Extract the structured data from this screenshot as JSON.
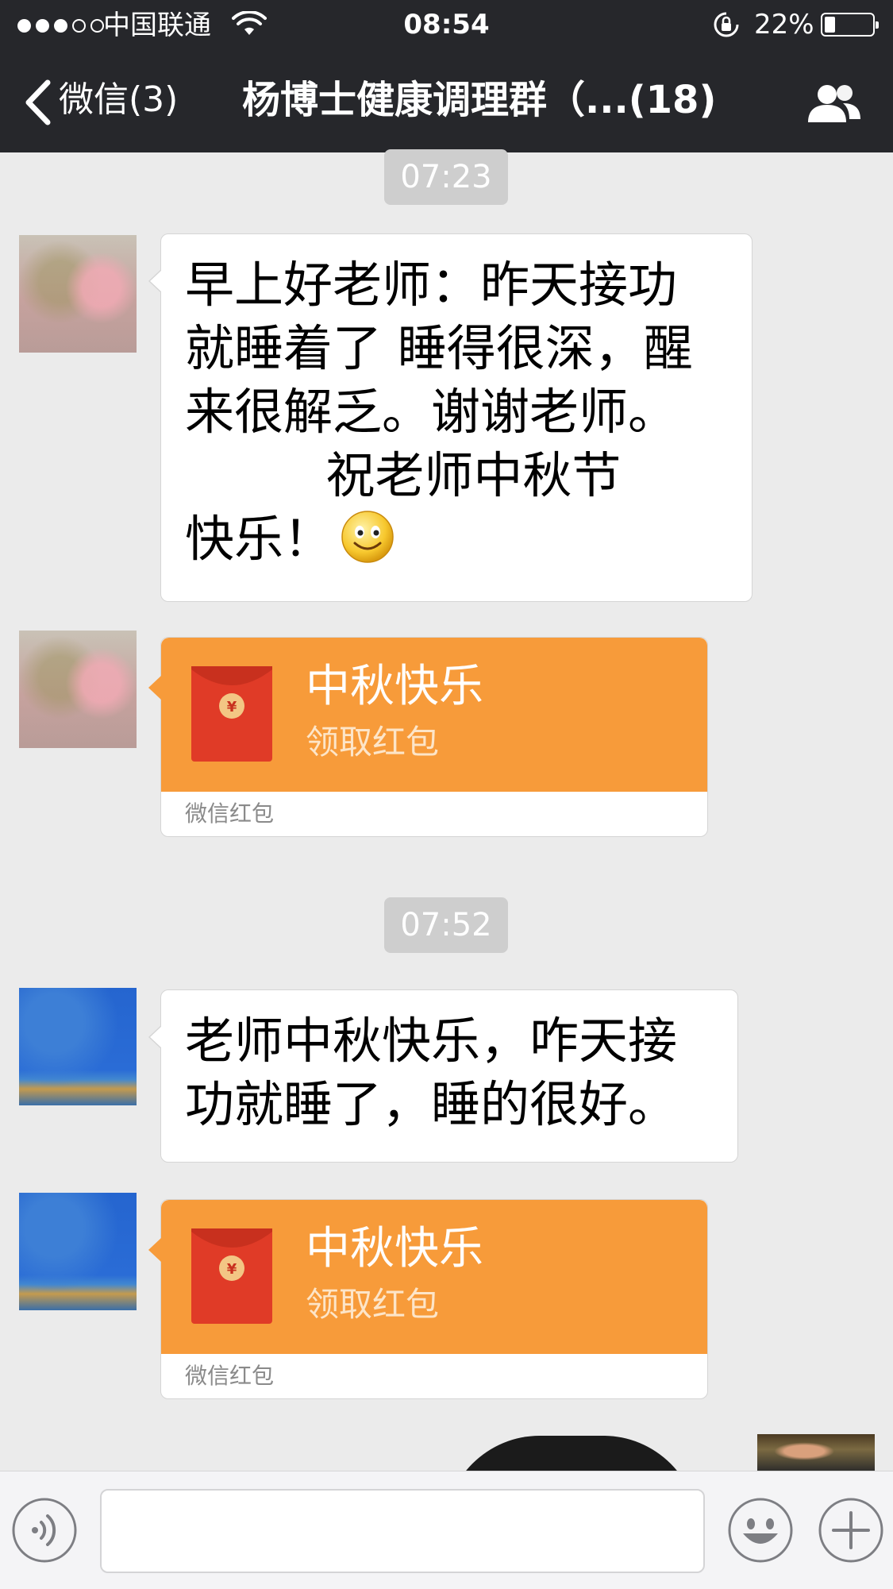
{
  "status_bar": {
    "carrier": "中国联通",
    "time": "08:54",
    "battery_percent": "22%",
    "battery_level": 0.22,
    "signal_bars": 3,
    "signal_total": 5
  },
  "nav": {
    "back_label": "微信(3)",
    "title": "杨博士健康调理群（...(18)",
    "group_icon": "group-members-icon"
  },
  "messages": [
    {
      "type": "timestamp",
      "text": "07:23"
    },
    {
      "type": "text",
      "avatar": "pink-flower-avatar",
      "lines": [
        "早上好老师：昨天接功",
        "就睡着了 睡得很深，醒",
        "来很解乏。谢谢老师。",
        "         祝老师中秋节",
        "快乐！"
      ],
      "emoji": "smile-emoji"
    },
    {
      "type": "red_packet",
      "avatar": "pink-flower-avatar",
      "title": "中秋快乐",
      "subtitle": "领取红包",
      "footer": "微信红包"
    },
    {
      "type": "timestamp",
      "text": "07:52"
    },
    {
      "type": "text",
      "avatar": "blue-sky-avatar",
      "lines": [
        "老师中秋快乐，咋天接",
        "功就睡了，睡的很好。"
      ]
    },
    {
      "type": "red_packet",
      "avatar": "blue-sky-avatar",
      "title": "中秋快乐",
      "subtitle": "领取红包",
      "footer": "微信红包"
    }
  ],
  "input_bar": {
    "voice_icon": "voice-icon",
    "emoji_icon": "emoji-icon",
    "plus_icon": "plus-icon"
  },
  "colors": {
    "bar_bg": "#26272b",
    "chat_bg": "#ebebeb",
    "packet_orange": "#f79b3a",
    "timestamp_bg": "#cecece"
  }
}
